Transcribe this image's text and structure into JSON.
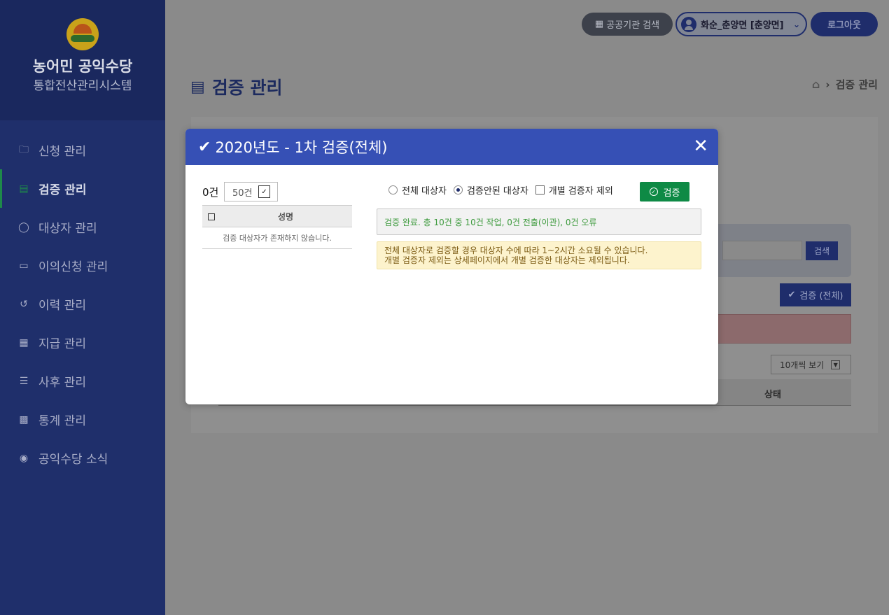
{
  "sidebar": {
    "title": "농어민 공익수당",
    "subtitle": "통합전산관리시스템",
    "items": [
      {
        "label": "신청 관리",
        "icon": "folder-icon"
      },
      {
        "label": "검증 관리",
        "icon": "document-icon",
        "active": true
      },
      {
        "label": "대상자 관리",
        "icon": "user-icon"
      },
      {
        "label": "이의신청 관리",
        "icon": "monitor-icon"
      },
      {
        "label": "이력 관리",
        "icon": "history-icon"
      },
      {
        "label": "지급 관리",
        "icon": "calculator-icon"
      },
      {
        "label": "사후 관리",
        "icon": "checklist-icon"
      },
      {
        "label": "통계 관리",
        "icon": "bar-chart-icon"
      },
      {
        "label": "공익수당 소식",
        "icon": "chat-icon"
      }
    ]
  },
  "header": {
    "org_search_label": "공공기관 검색",
    "user_label": "화순_춘양면 [춘양면]",
    "logout_label": "로그아웃"
  },
  "page": {
    "title": "검증 관리",
    "breadcrumb": "검증 관리"
  },
  "background": {
    "search_button": "검색",
    "verify_all_button": "검증 (전체)",
    "page_size_select": "10개씩 보기",
    "status_header": "상태"
  },
  "modal": {
    "title": "2020년도 - 1차 검증(전체)",
    "count": "0건",
    "page_size": "50건",
    "table_header": "성명",
    "empty_message": "검증 대상자가 존재하지 않습니다.",
    "options": {
      "all_label": "전체 대상자",
      "unverified_label": "검증안된 대상자",
      "exclude_label": "개별 검증자 제외"
    },
    "verify_button": "검증",
    "result_message": "검증 완료. 총 10건 중 10건 작업, 0건 전출(이관), 0건 오류",
    "notice_line1": "전체 대상자로 검증할 경우 대상자 수에 따라 1~2시간 소요될 수 있습니다.",
    "notice_line2": "개별 검증자 제외는 상세페이지에서 개별 검증한 대상자는 제외됩니다."
  },
  "colors": {
    "sidebar": "#1f2f6b",
    "modal_header": "#3650b5",
    "verify_button": "#0e8a45",
    "result_text": "#3d9a3d",
    "notice_bg": "#fdf3cd"
  }
}
